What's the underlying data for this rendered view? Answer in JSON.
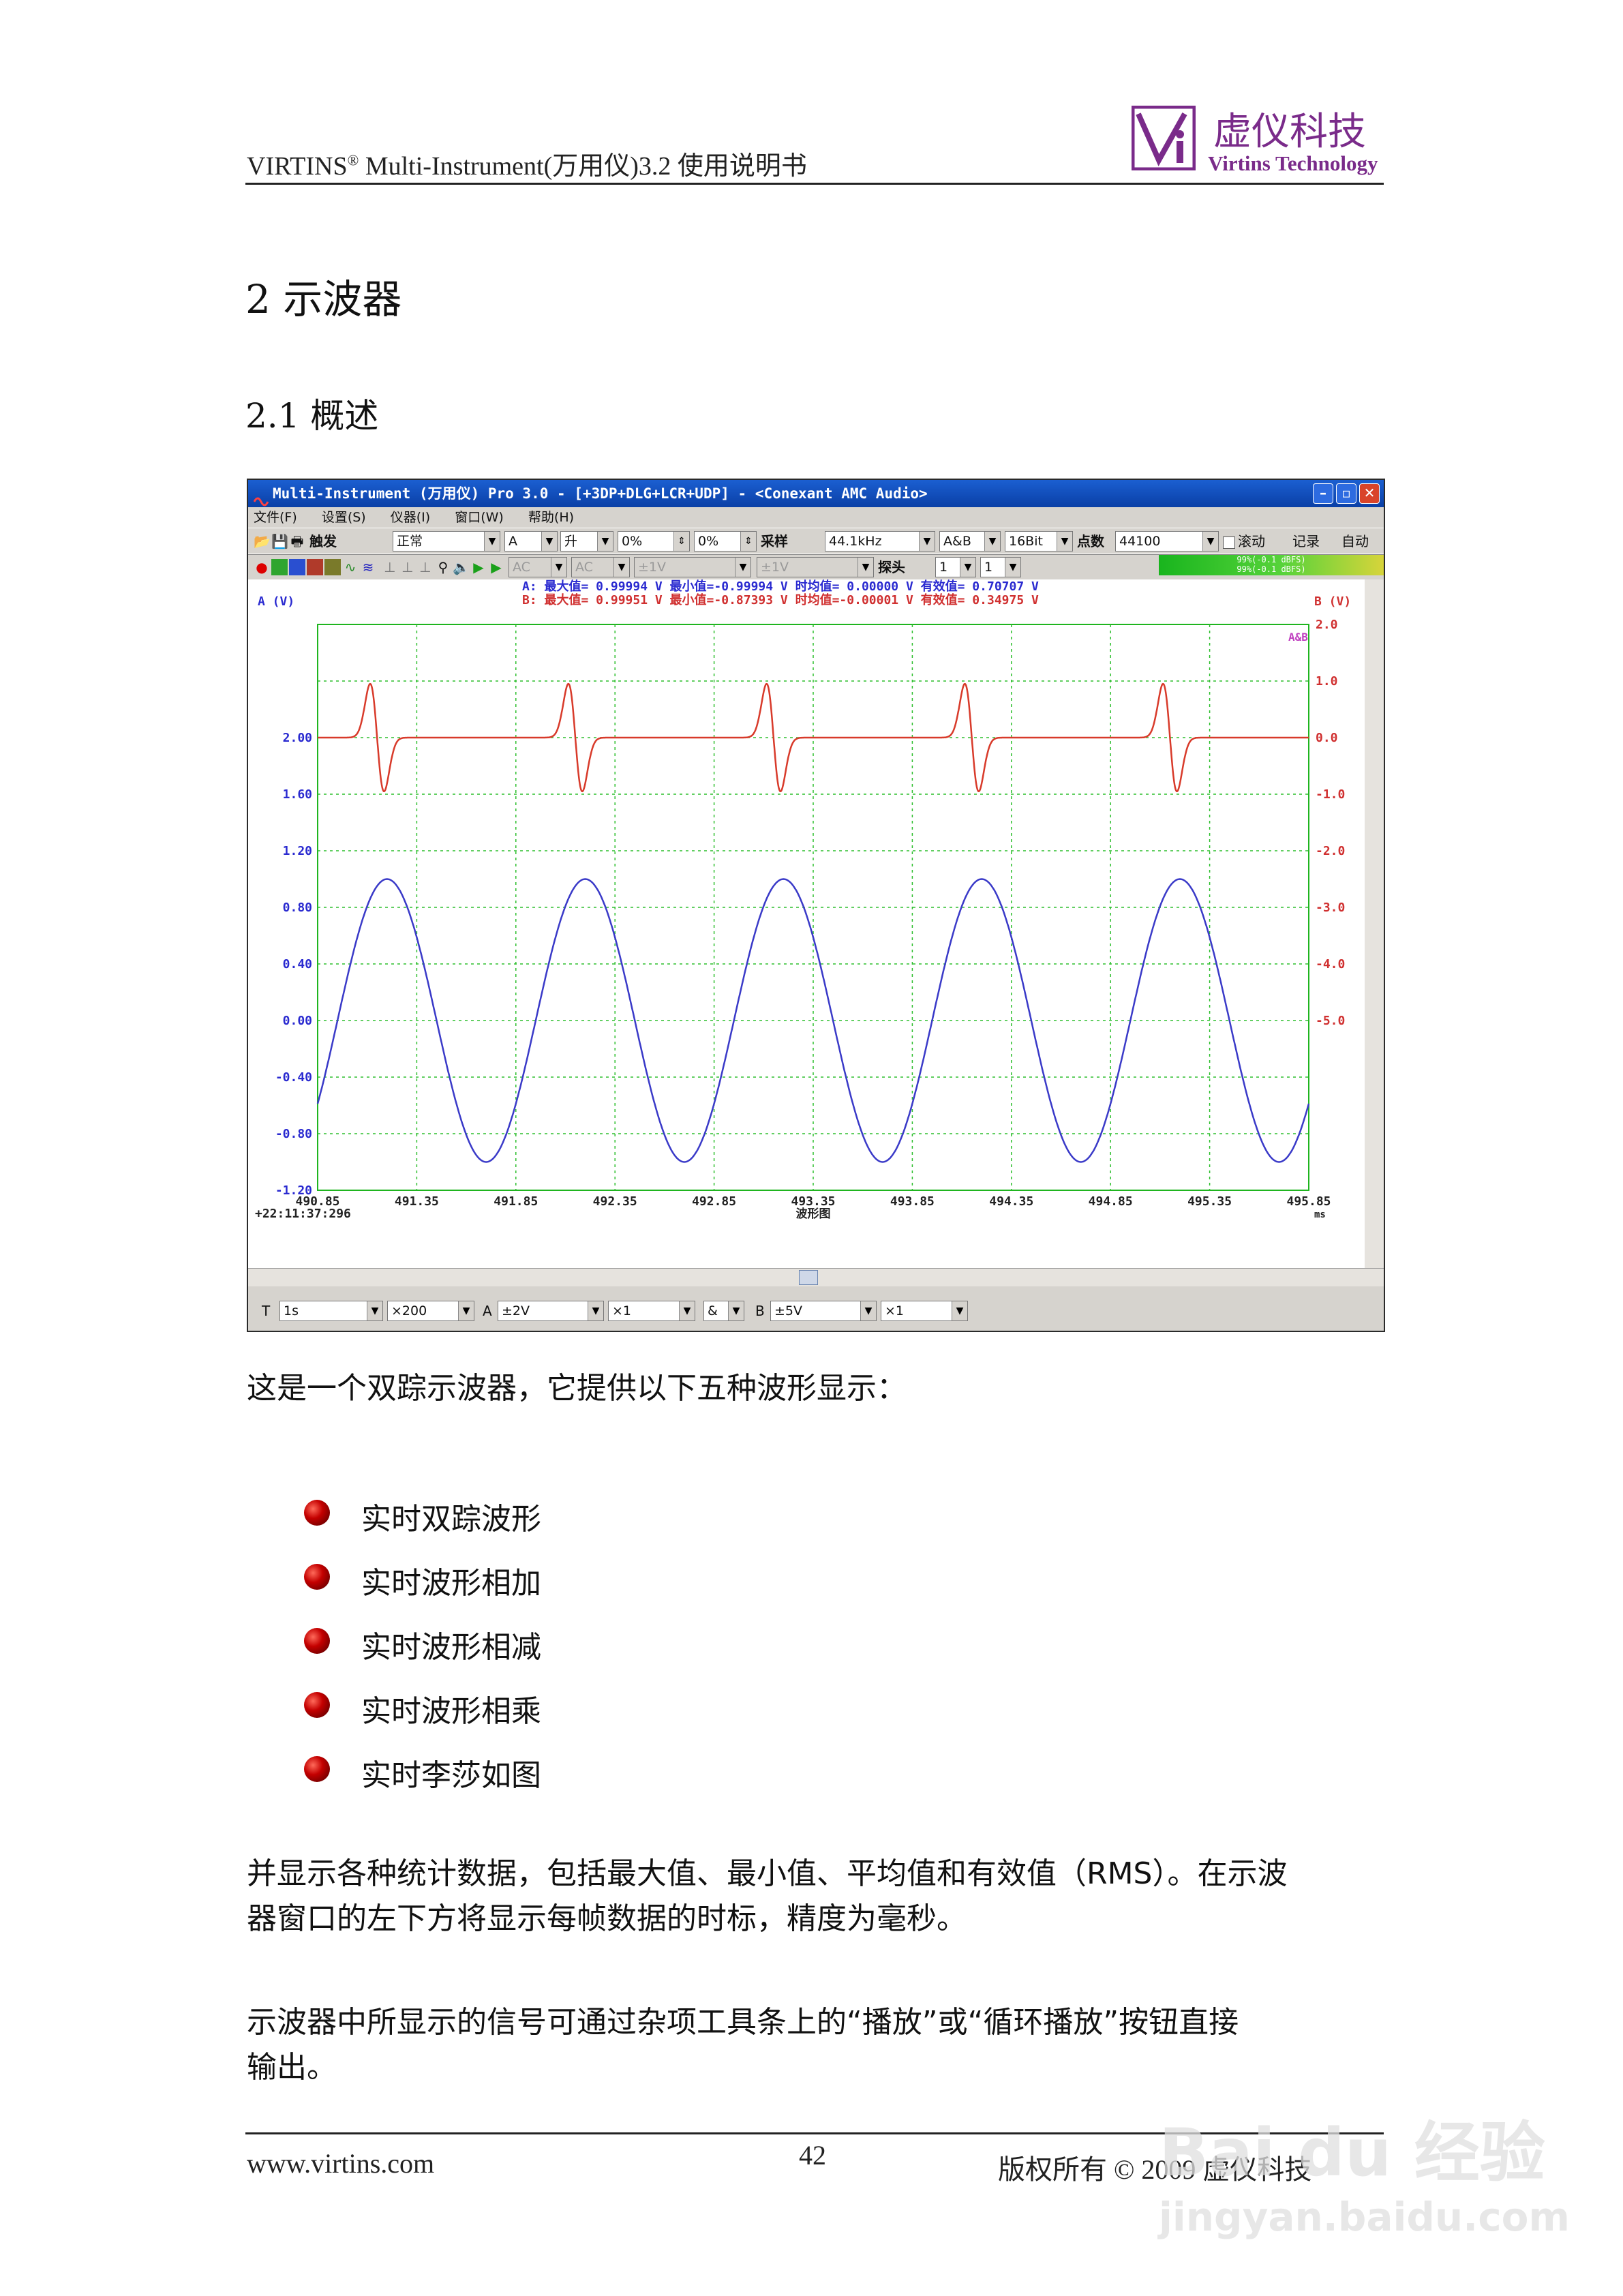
{
  "header": {
    "doc_title": "VIRTINS",
    "doc_title_sup": "®",
    "doc_title_rest": " Multi-Instrument(万用仪)3.2 使用说明书",
    "logo_cn": "虚仪科技",
    "logo_en": "Virtins Technology",
    "logo_mark": "Vi"
  },
  "section": {
    "h1": "2 示波器",
    "h2": "2.1 概述"
  },
  "app": {
    "title": "Multi-Instrument (万用仪) Pro 3.0  -  [+3DP+DLG+LCR+UDP]  -  <Conexant AMC Audio>",
    "menu": [
      "文件(F)",
      "设置(S)",
      "仪器(I)",
      "窗口(W)",
      "帮助(H)"
    ],
    "toolbar1": {
      "trigger_label": "触发",
      "trigger_mode": "正常",
      "channel": "A",
      "edge": "升",
      "level1": "0%",
      "level2": "0%",
      "sample_label": "采样",
      "sample_rate": "44.1kHz",
      "channels": "A&B",
      "bits": "16Bit",
      "points_label": "点数",
      "points": "44100",
      "scroll_label": "滚动",
      "record_label": "记录",
      "auto_label": "自动"
    },
    "toolbar2": {
      "coupling_a": "AC",
      "coupling_b": "AC",
      "range_a": "±1V",
      "range_b": "±1V",
      "probe_label": "探头",
      "probe_a": "1",
      "probe_b": "1",
      "meter_a": "99%(-0.1 dBFS)",
      "meter_b": "99%(-0.1 dBFS)"
    },
    "stats": {
      "a_line": "A:  最大值= 0.99994 V   最小值=-0.99994 V   时均值= 0.00000 V   有效值= 0.70707 V",
      "b_line": "B:  最大值= 0.99951 V   最小值=-0.87393 V   时均值=-0.00001 V   有效值= 0.34975 V"
    },
    "plot": {
      "left_axis_label": "A (V)",
      "right_axis_label": "B (V)",
      "x_unit": "ms",
      "x_title": "波形图",
      "timestamp": "+22:11:37:296",
      "legend_tag": "A&B"
    },
    "bottom": {
      "t_label": "T",
      "timebase": "1s",
      "zoom": "×200",
      "a_label": "A",
      "a_range": "±2V",
      "a_zoom": "×1",
      "op": "&",
      "b_label": "B",
      "b_range": "±5V",
      "b_zoom": "×1"
    }
  },
  "chart_data": {
    "type": "line",
    "x_ticks": [
      "490.85",
      "491.35",
      "491.85",
      "492.35",
      "492.85",
      "493.35",
      "493.85",
      "494.35",
      "494.85",
      "495.35",
      "495.85"
    ],
    "y_left_ticks": [
      "2.00",
      "1.60",
      "1.20",
      "0.80",
      "0.40",
      "0.00",
      "-0.40",
      "-0.80",
      "-1.20"
    ],
    "y_right_ticks": [
      "2.0",
      "1.0",
      "0.0",
      "-1.0",
      "-2.0",
      "-3.0",
      "-4.0",
      "-5.0"
    ],
    "xlim": [
      490.85,
      495.85
    ],
    "series": [
      {
        "name": "A",
        "color": "#3a3ac8",
        "shape": "sine",
        "amplitude": 1.0,
        "period_ms": 1.0
      },
      {
        "name": "B",
        "color": "#d83a2a",
        "shape": "differentiated-pulse",
        "amplitude": 1.0,
        "period_ms": 1.0
      }
    ]
  },
  "intro": "这是一个双踪示波器，它提供以下五种波形显示：",
  "bullets": [
    "实时双踪波形",
    "实时波形相加",
    "实时波形相减",
    "实时波形相乘",
    "实时李莎如图"
  ],
  "para1_l1": "并显示各种统计数据，包括最大值、最小值、平均值和有效值（RMS）。在示波",
  "para1_l2": "器窗口的左下方将显示每帧数据的时标，精度为毫秒。",
  "para2_l1": "示波器中所显示的信号可通过杂项工具条上的“播放”或“循环播放”按钮直接",
  "para2_l2": "输出。",
  "footer": {
    "site": "www.virtins.com",
    "page": "42",
    "copyright": "版权所有 © 2009 虚仪科技"
  },
  "watermark": {
    "brand": "Bai du 经验",
    "url": "jingyan.baidu.com"
  }
}
